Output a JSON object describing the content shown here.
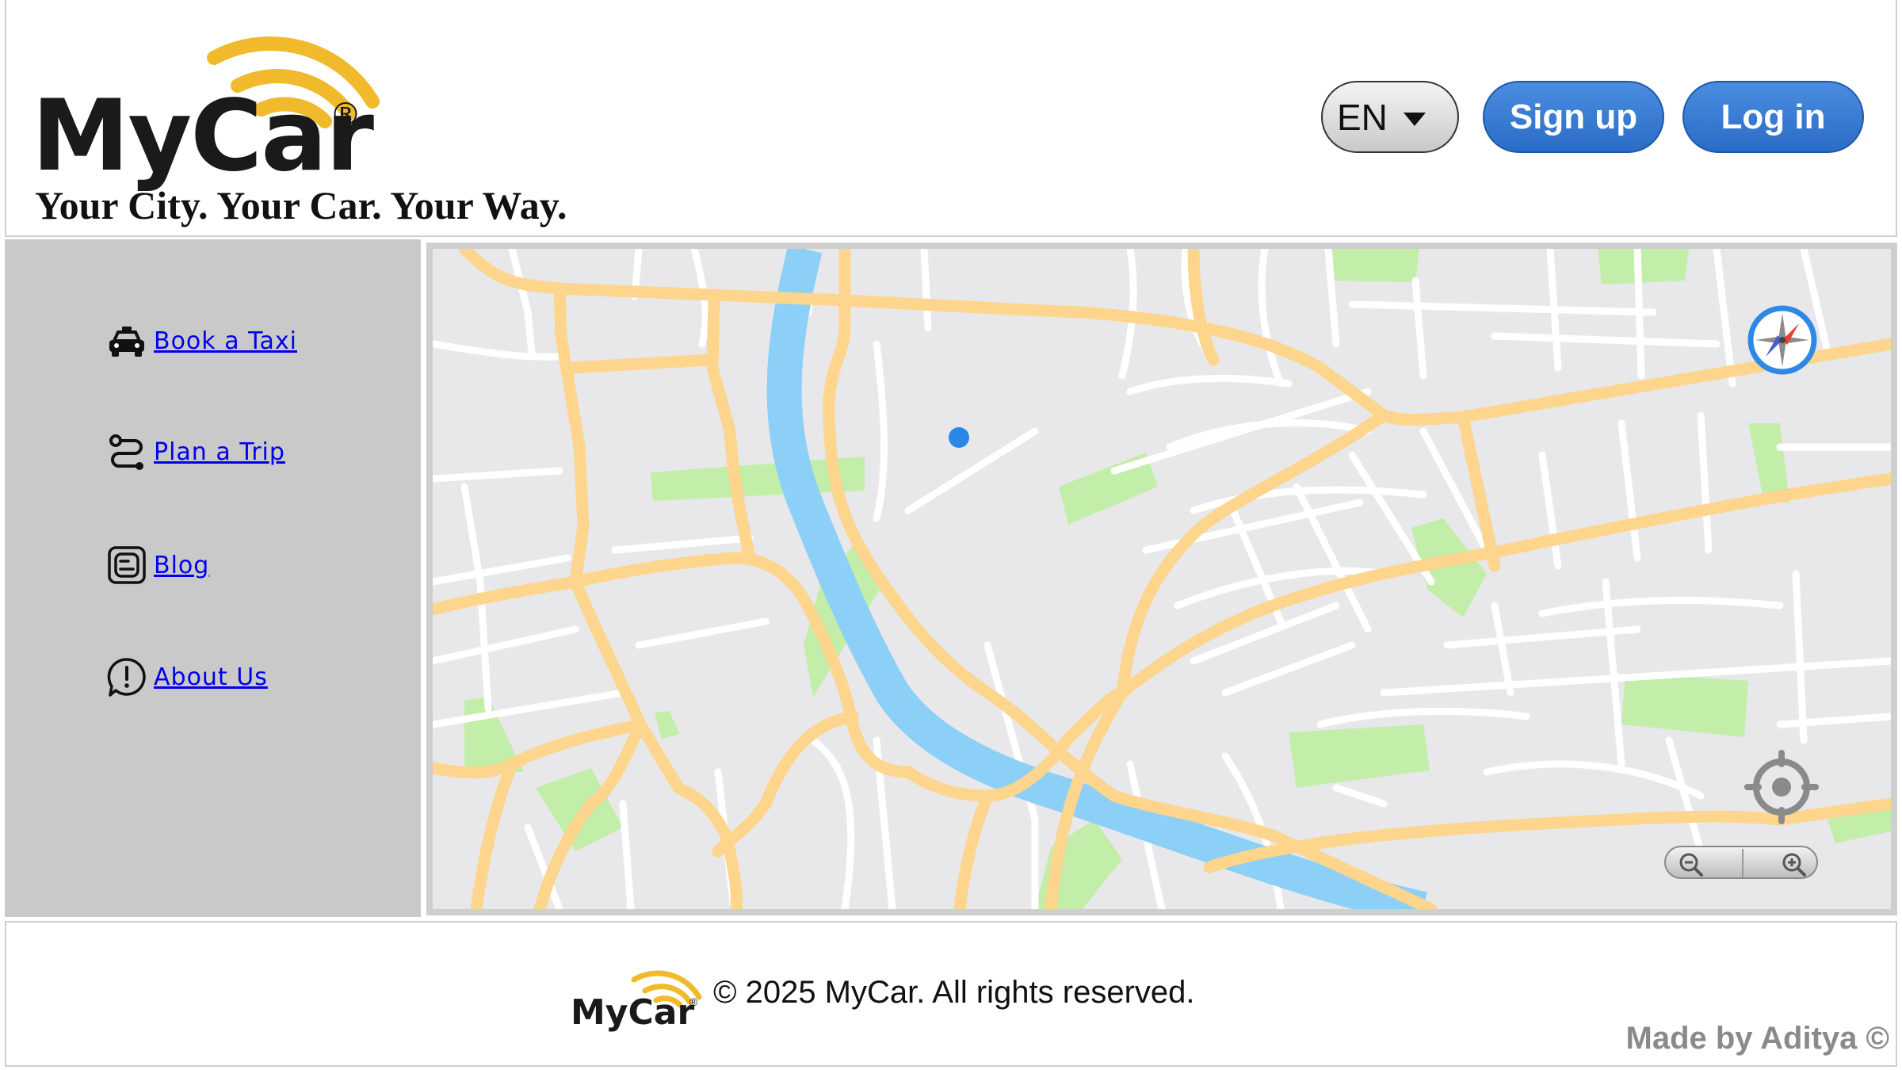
{
  "header": {
    "brand": "MyCar",
    "brand_mark": "®",
    "tagline": "Your City. Your Car. Your Way.",
    "language": "EN",
    "signup_label": "Sign up",
    "login_label": "Log in"
  },
  "sidebar": {
    "items": [
      {
        "label": "Book a Taxi",
        "icon": "taxi-icon"
      },
      {
        "label": "Plan a Trip",
        "icon": "route-icon"
      },
      {
        "label": "Blog",
        "icon": "blog-icon"
      },
      {
        "label": "About Us",
        "icon": "info-bubble-icon"
      }
    ]
  },
  "map": {
    "controls": [
      "compass-icon",
      "locate-icon",
      "zoom-out-icon",
      "zoom-in-icon"
    ]
  },
  "footer": {
    "brand": "MyCar",
    "brand_mark": "®",
    "copyright": "© 2025 MyCar. All rights reserved.",
    "made_by": "Made by Aditya ©"
  },
  "colors": {
    "accent_blue": "#2f72cc",
    "logo_yellow": "#f1b92c",
    "sidebar_gray": "#c9c9c9",
    "road": "#fdd58c",
    "river": "#8cd0f8",
    "park": "#c2eeaa",
    "location_dot": "#2a87e6"
  }
}
